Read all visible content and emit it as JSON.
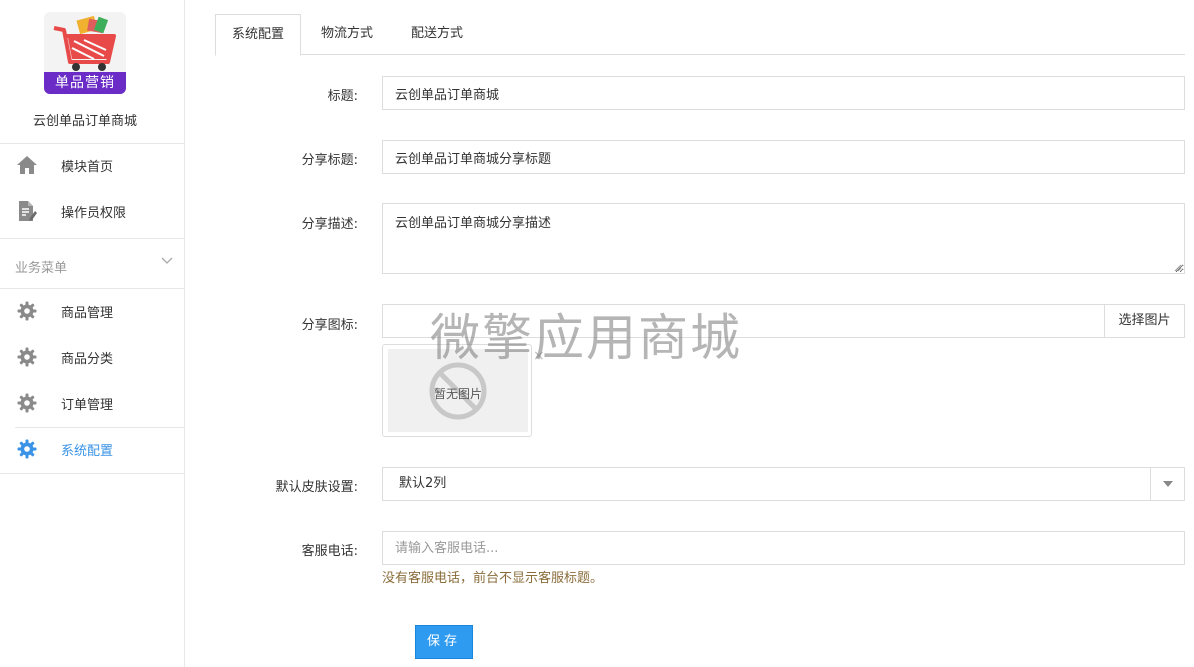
{
  "sidebar": {
    "logo_text": "单品营销",
    "app_name": "云创单品订单商城",
    "top_items": [
      {
        "label": "模块首页",
        "icon": "home-icon"
      },
      {
        "label": "操作员权限",
        "icon": "document-edit-icon"
      }
    ],
    "section_title": "业务菜单",
    "menu_items": [
      {
        "label": "商品管理",
        "icon": "gear-icon"
      },
      {
        "label": "商品分类",
        "icon": "gear-icon"
      },
      {
        "label": "订单管理",
        "icon": "gear-icon"
      },
      {
        "label": "系统配置",
        "icon": "gear-icon",
        "active": true
      }
    ]
  },
  "tabs": [
    {
      "label": "系统配置",
      "active": true
    },
    {
      "label": "物流方式"
    },
    {
      "label": "配送方式"
    }
  ],
  "form": {
    "title_label": "标题:",
    "title_value": "云创单品订单商城",
    "share_title_label": "分享标题:",
    "share_title_value": "云创单品订单商城分享标题",
    "share_desc_label": "分享描述:",
    "share_desc_value": "云创单品订单商城分享描述",
    "share_icon_label": "分享图标:",
    "share_icon_value": "",
    "pick_image_button": "选择图片",
    "no_image_text": "暂无图片",
    "close_symbol": "×",
    "skin_label": "默认皮肤设置:",
    "skin_value": "默认2列",
    "phone_label": "客服电话:",
    "phone_placeholder": "请输入客服电话...",
    "phone_value": "",
    "phone_hint": "没有客服电话，前台不显示客服标题。",
    "save_button": "保存"
  },
  "watermark": "微擎应用商城",
  "colors": {
    "accent": "#3a93e6",
    "save_button": "#2f9bf0",
    "hint": "#8a6d3b",
    "logo_banner": "#6a2bc6",
    "cart": "#e84a4a"
  }
}
